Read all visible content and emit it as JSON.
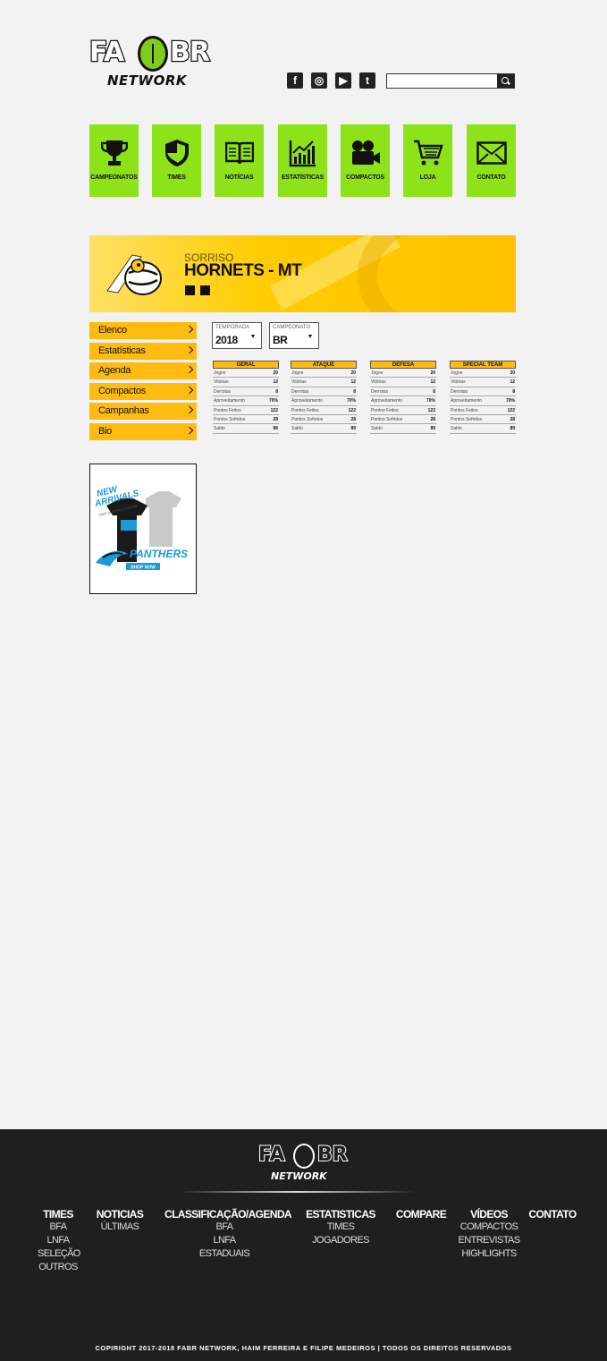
{
  "header": {
    "logo_text_left": "FA",
    "logo_text_right": "BR",
    "logo_sub": "NETWORK",
    "social": [
      {
        "icon": "facebook-icon",
        "glyph": "f"
      },
      {
        "icon": "instagram-icon",
        "glyph": "◎"
      },
      {
        "icon": "youtube-icon",
        "glyph": "▶"
      },
      {
        "icon": "twitter-icon",
        "glyph": "t"
      }
    ],
    "search_placeholder": ""
  },
  "nav": [
    {
      "label": "CAMPEONATOS",
      "icon": "trophy-icon"
    },
    {
      "label": "TIMES",
      "icon": "shield-icon"
    },
    {
      "label": "NOTÍCIAS",
      "icon": "book-icon"
    },
    {
      "label": "ESTATÍSTICAS",
      "icon": "chart-icon"
    },
    {
      "label": "COMPACTOS",
      "icon": "camera-icon"
    },
    {
      "label": "LOJA",
      "icon": "cart-icon"
    },
    {
      "label": "CONTATO",
      "icon": "mail-icon"
    }
  ],
  "team": {
    "city": "SORRISO",
    "name": "HORNETS - MT",
    "colors": {
      "accent": "#ffcc00",
      "nav": "#8ee21a",
      "menu": "#ffbb0f"
    }
  },
  "side_menu": [
    "Elenco",
    "Estatísticas",
    "Agenda",
    "Compactos",
    "Campanhas",
    "Bio"
  ],
  "filters": {
    "season": {
      "label": "TEMPORADA",
      "value": "2018"
    },
    "championship": {
      "label": "CAMPEONATO",
      "value": "BR"
    }
  },
  "stats": [
    {
      "title": "GERAL",
      "rows": [
        [
          "Jogos",
          "20"
        ],
        [
          "Vitórias",
          "12"
        ],
        [
          "Derrotas",
          "8"
        ],
        [
          "Aproveitamento",
          "70%"
        ],
        [
          "Pontos Feitos",
          "122"
        ],
        [
          "Pontos Sofridos",
          "28"
        ],
        [
          "Saldo",
          "89"
        ]
      ]
    },
    {
      "title": "ATAQUE",
      "rows": [
        [
          "Jogos",
          "20"
        ],
        [
          "Vitórias",
          "12"
        ],
        [
          "Derrotas",
          "8"
        ],
        [
          "Aproveitamento",
          "70%"
        ],
        [
          "Pontos Feitos",
          "122"
        ],
        [
          "Pontos Sofridos",
          "28"
        ],
        [
          "Saldo",
          "89"
        ]
      ]
    },
    {
      "title": "DEFESA",
      "rows": [
        [
          "Jogos",
          "20"
        ],
        [
          "Vitórias",
          "12"
        ],
        [
          "Derrotas",
          "8"
        ],
        [
          "Aproveitamento",
          "70%"
        ],
        [
          "Pontos Feitos",
          "122"
        ],
        [
          "Pontos Sofridos",
          "28"
        ],
        [
          "Saldo",
          "89"
        ]
      ]
    },
    {
      "title": "SPECIAL TEAM",
      "rows": [
        [
          "Jogos",
          "20"
        ],
        [
          "Vitórias",
          "12"
        ],
        [
          "Derrotas",
          "8"
        ],
        [
          "Aproveitamento",
          "70%"
        ],
        [
          "Pontos Feitos",
          "122"
        ],
        [
          "Pontos Sofridos",
          "28"
        ],
        [
          "Saldo",
          "89"
        ]
      ]
    }
  ],
  "ad": {
    "headline_1": "NEW",
    "headline_2": "ARRIVALS",
    "small": "FREE SHIPPING OVER $50",
    "brand": "PANTHERS",
    "cta": "SHOP NOW"
  },
  "footer": {
    "logo_text_left": "FA",
    "logo_text_right": "BR",
    "logo_sub": "NETWORK",
    "columns": [
      {
        "title": "TIMES",
        "links": [
          "BFA",
          "LNFA",
          "SELEÇÃO",
          "OUTROS"
        ]
      },
      {
        "title": "NOTICIAS",
        "links": [
          "ÚLTIMAS"
        ]
      },
      {
        "title": "CLASSIFICAÇÃO/AGENDA",
        "links": [
          "BFA",
          "LNFA",
          "ESTADUAIS"
        ]
      },
      {
        "title": "ESTATISTICAS",
        "links": [
          "TIMES",
          "JOGADORES"
        ]
      },
      {
        "title": "COMPARE",
        "links": []
      },
      {
        "title": "VÍDEOS",
        "links": [
          "COMPACTOS",
          "ENTREVISTAS",
          "HIGHLIGHTS"
        ]
      },
      {
        "title": "CONTATO",
        "links": []
      }
    ],
    "copyright": "COPIRIGHT 2017-2018 FABR NETWORK, HAIM FERREIRA E FILIPE MEDEIROS | TODOS OS DIREITOS RESERVADOS"
  }
}
